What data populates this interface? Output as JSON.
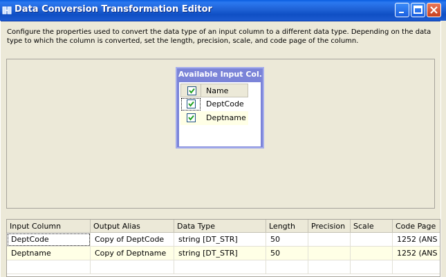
{
  "window": {
    "title": "Data Conversion Transformation Editor",
    "icons": {
      "app": "data-conversion-icon",
      "minimize": "minimize-icon",
      "maximize": "maximize-icon",
      "close": "close-icon"
    }
  },
  "description": "Configure the properties used to convert the data type of an input column to a different data type. Depending on the data type to which the column is converted, set the length, precision, scale, and code page of the column.",
  "available_columns": {
    "title": "Available Input Col...",
    "header": "Name",
    "header_checked": true,
    "items": [
      {
        "name": "DeptCode",
        "checked": true
      },
      {
        "name": "Deptname",
        "checked": true
      }
    ]
  },
  "conversion_grid": {
    "columns": [
      "Input Column",
      "Output Alias",
      "Data Type",
      "Length",
      "Precision",
      "Scale",
      "Code Page"
    ],
    "rows": [
      {
        "input": "DeptCode",
        "alias": "Copy of DeptCode",
        "type": "string [DT_STR]",
        "length": "50",
        "precision": "",
        "scale": "",
        "codepage": "1252  (ANS"
      },
      {
        "input": "Deptname",
        "alias": "Copy of Deptname",
        "type": "string [DT_STR]",
        "length": "50",
        "precision": "",
        "scale": "",
        "codepage": "1252  (ANS"
      }
    ]
  },
  "colors": {
    "titlebar": "#0a5fe0",
    "checkmark": "#21a121",
    "row_highlight": "#ffffe6"
  }
}
